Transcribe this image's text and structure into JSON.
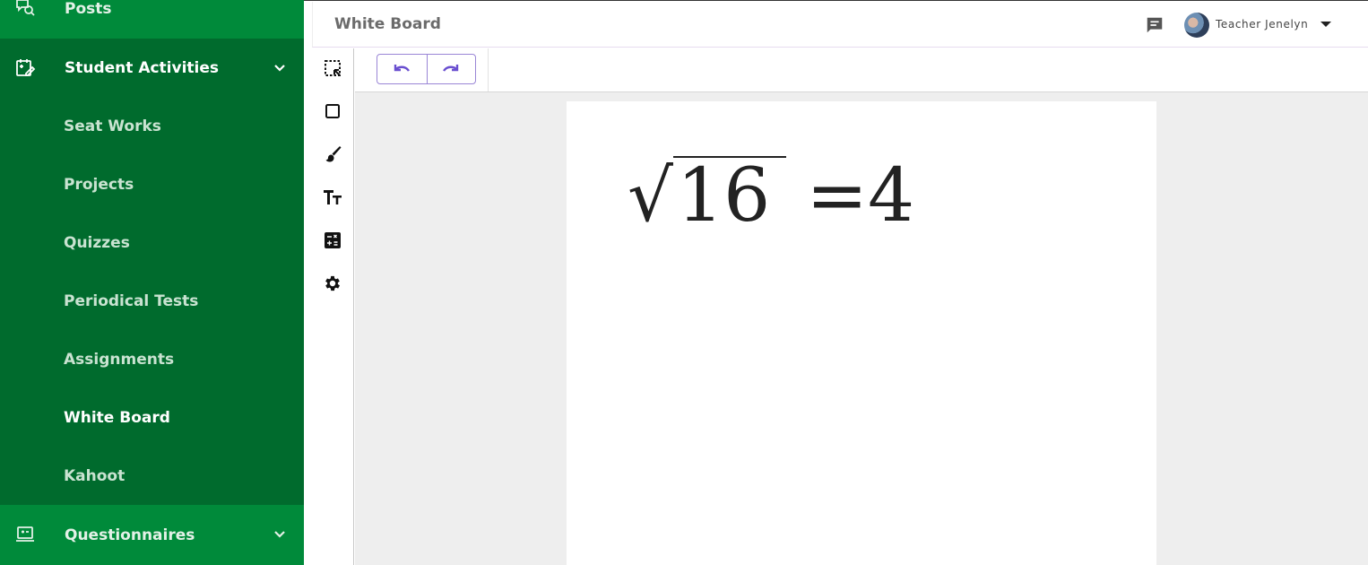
{
  "sidebar": {
    "posts_label": "Posts",
    "student_activities_label": "Student Activities",
    "sub_items": [
      "Seat Works",
      "Projects",
      "Quizzes",
      "Periodical Tests",
      "Assignments",
      "White Board",
      "Kahoot"
    ],
    "active_item": "White Board",
    "questionnaires_label": "Questionnaires"
  },
  "header": {
    "title": "White Board",
    "user_name": "Teacher Jenelyn",
    "icons": [
      "chat-icon",
      "avatar",
      "caret-down-icon"
    ]
  },
  "tools": [
    "select-area-icon",
    "rectangle-icon",
    "brush-icon",
    "text-size-icon",
    "calculator-icon",
    "gear-icon"
  ],
  "toolbar": {
    "buttons": [
      "undo-icon",
      "redo-icon"
    ],
    "accent": "#6a4fd0"
  },
  "board": {
    "radical": "√",
    "radicand": "16",
    "equals": "=",
    "result": "4"
  },
  "colors": {
    "sidebar_bg": "#006b2d",
    "sidebar_top_bg": "#008a3a",
    "canvas_bg": "#eeeeee"
  }
}
